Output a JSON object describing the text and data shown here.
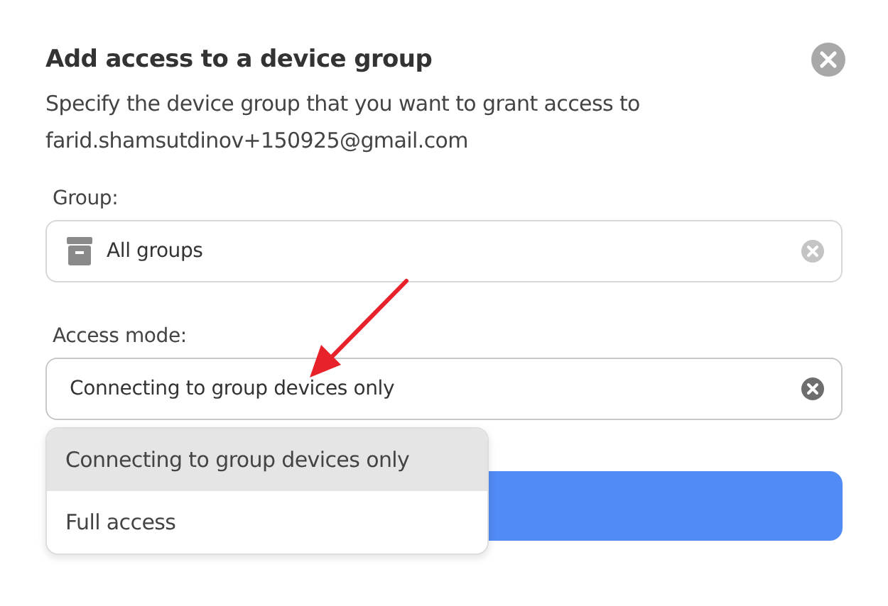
{
  "dialog": {
    "title": "Add access to a device group",
    "description": "Specify the device group that you want to grant access to farid.shamsutdinov+150925@gmail.com"
  },
  "group_field": {
    "label": "Group:",
    "value": "All groups"
  },
  "access_mode_field": {
    "label": "Access mode:",
    "value": "Connecting to group devices only"
  },
  "dropdown": {
    "options": [
      {
        "label": "Connecting to group devices only",
        "selected": true
      },
      {
        "label": "Full access",
        "selected": false
      }
    ]
  },
  "annotation": {
    "kind": "arrow"
  }
}
